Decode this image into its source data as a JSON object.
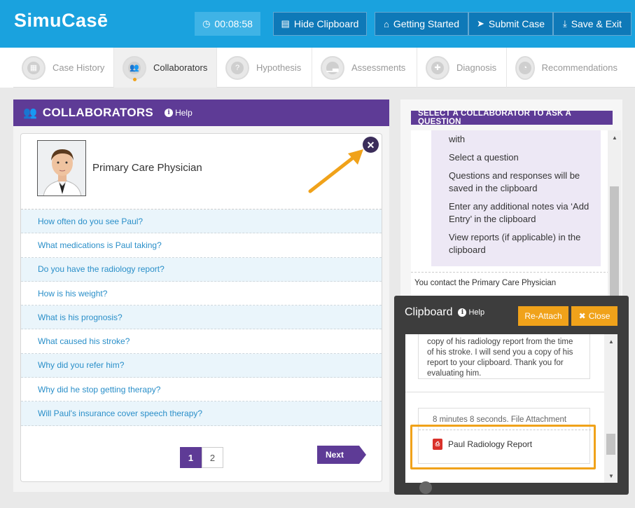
{
  "app": {
    "logo": "SimuCasē",
    "timer": "00:08:58",
    "buttons": {
      "hide_clipboard": "Hide Clipboard",
      "getting_started": "Getting Started",
      "submit_case": "Submit Case",
      "save_exit": "Save & Exit"
    },
    "accent_color": "#1aa2de",
    "purple": "#5e3b96",
    "orange": "#f0a21a"
  },
  "tabs": [
    {
      "label": "Case History"
    },
    {
      "label": "Collaborators"
    },
    {
      "label": "Hypothesis"
    },
    {
      "label": "Assessments"
    },
    {
      "label": "Diagnosis"
    },
    {
      "label": "Recommendations"
    }
  ],
  "collaborators": {
    "title": "COLLABORATORS",
    "help": "Help",
    "person": "Primary Care Physician",
    "questions": [
      "How often do you see Paul?",
      "What medications is Paul taking?",
      "Do you have the radiology report?",
      "How is his weight?",
      "What is his prognosis?",
      "What caused his stroke?",
      "Why did you refer him?",
      "Why did he stop getting therapy?",
      "Will Paul's insurance cover speech therapy?"
    ],
    "pages": [
      "1",
      "2"
    ],
    "next": "Next"
  },
  "ask": {
    "title": "SELECT A COLLABORATOR TO ASK A QUESTION",
    "instructions": [
      "with",
      "Select a question",
      "Questions and responses will be saved in the clipboard",
      "Enter any additional notes via ‘Add Entry’ in the clipboard",
      "View reports (if applicable) in the clipboard"
    ],
    "contact": "You contact the Primary Care Physician"
  },
  "clipboard": {
    "title": "Clipboard",
    "help": "Help",
    "reattach": "Re-Attach",
    "close": "Close",
    "entry_text": "copy of his radiology report from the time of his stroke. I will send you a copy of his report to your clipboard. Thank you for evaluating him.",
    "entry_meta": "8 minutes 8 seconds. File Attachment",
    "attachment": "Paul Radiology Report"
  }
}
